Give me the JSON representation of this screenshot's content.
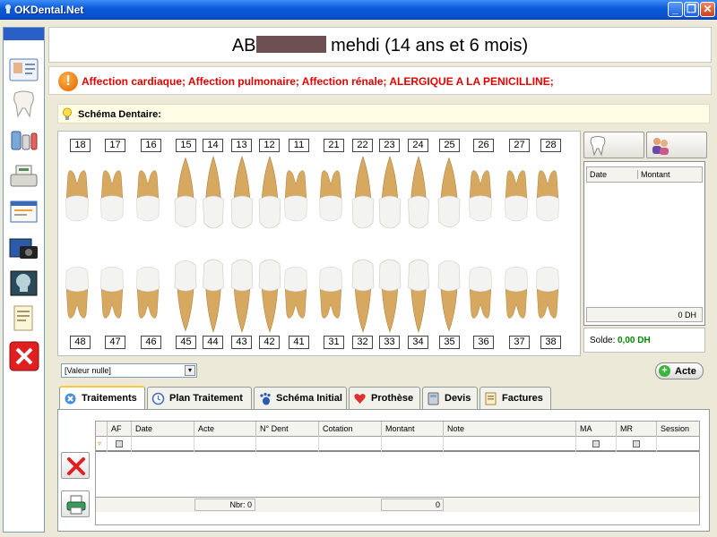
{
  "window": {
    "title": "OKDental.Net"
  },
  "header": {
    "name_prefix": "AB",
    "name_suffix": "mehdi (14 ans et 6 mois)"
  },
  "alert": {
    "text": "Affection cardiaque; Affection pulmonaire; Affection rénale; ALERGIQUE  A LA PENICILLINE;"
  },
  "schema": {
    "label": "Schéma Dentaire:"
  },
  "teeth": {
    "upper": [
      "18",
      "17",
      "16",
      "15",
      "14",
      "13",
      "12",
      "11",
      "21",
      "22",
      "23",
      "24",
      "25",
      "26",
      "27",
      "28"
    ],
    "lower": [
      "48",
      "47",
      "46",
      "45",
      "44",
      "43",
      "42",
      "41",
      "31",
      "32",
      "33",
      "34",
      "35",
      "36",
      "37",
      "38"
    ]
  },
  "payments": {
    "columns": [
      "Date",
      "Montant"
    ],
    "total": "0 DH",
    "solde_label": "Solde:",
    "solde_value": "0,00 DH"
  },
  "filter": {
    "selected": "[Valeur nulle]"
  },
  "actions": {
    "acte_label": "Acte"
  },
  "tabs": [
    {
      "label": "Traitements",
      "icon": "treatment-icon"
    },
    {
      "label": "Plan Traitement",
      "icon": "clock-icon"
    },
    {
      "label": "Schéma Initial",
      "icon": "footprint-icon"
    },
    {
      "label": "Prothèse",
      "icon": "heart-icon"
    },
    {
      "label": "Devis",
      "icon": "calculator-icon"
    },
    {
      "label": "Factures",
      "icon": "invoice-icon"
    }
  ],
  "grid": {
    "columns": [
      "AF",
      "Date",
      "Acte",
      "N° Dent",
      "Cotation",
      "Montant",
      "Note",
      "MA",
      "MR",
      "Session"
    ],
    "footer_count": "Nbr: 0",
    "footer_sum": "0"
  },
  "colors": {
    "alert": "#e00000",
    "solde": "#008800",
    "titlebar": "#0a5ad9"
  }
}
